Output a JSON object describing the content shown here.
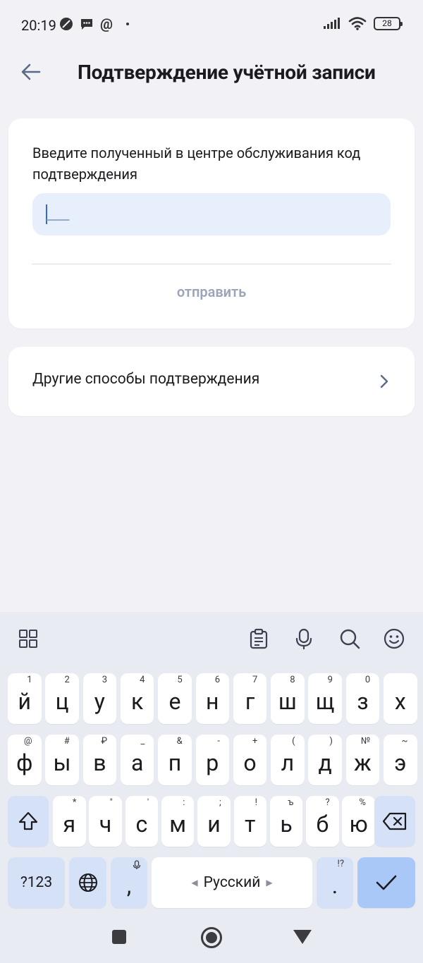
{
  "status_bar": {
    "time": "20:19",
    "battery": "28",
    "left_icons": [
      "moon-icon",
      "message-icon",
      "at-icon",
      "dot-icon"
    ],
    "right_icons": [
      "signal-icon",
      "wifi-icon",
      "battery-icon"
    ]
  },
  "header": {
    "title": "Подтверждение учётной записи",
    "back_icon": "arrow-left-icon"
  },
  "code_card": {
    "label": "Введите полученный в центре обслуживания код подтверждения",
    "input_value": "",
    "input_placeholder": "___",
    "send_label": "отправить"
  },
  "other_card": {
    "label": "Другие способы подтверждения",
    "chevron_icon": "chevron-right-icon"
  },
  "keyboard": {
    "toolbar": [
      "apps-grid-icon",
      "clipboard-icon",
      "mic-icon",
      "search-icon",
      "emoji-icon"
    ],
    "row1": [
      {
        "main": "й",
        "sub": "1"
      },
      {
        "main": "ц",
        "sub": "2"
      },
      {
        "main": "у",
        "sub": "3"
      },
      {
        "main": "к",
        "sub": "4"
      },
      {
        "main": "е",
        "sub": "5"
      },
      {
        "main": "н",
        "sub": "6"
      },
      {
        "main": "г",
        "sub": "7"
      },
      {
        "main": "ш",
        "sub": "8"
      },
      {
        "main": "щ",
        "sub": "9"
      },
      {
        "main": "з",
        "sub": "0"
      },
      {
        "main": "х",
        "sub": ""
      }
    ],
    "row2": [
      {
        "main": "ф",
        "sub": "@"
      },
      {
        "main": "ы",
        "sub": "#"
      },
      {
        "main": "в",
        "sub": "₽"
      },
      {
        "main": "а",
        "sub": "_"
      },
      {
        "main": "п",
        "sub": "&"
      },
      {
        "main": "р",
        "sub": "-"
      },
      {
        "main": "о",
        "sub": "+"
      },
      {
        "main": "л",
        "sub": "("
      },
      {
        "main": "д",
        "sub": ")"
      },
      {
        "main": "ж",
        "sub": "№"
      },
      {
        "main": "э",
        "sub": "~"
      }
    ],
    "row3": [
      {
        "main": "я",
        "sub": "*"
      },
      {
        "main": "ч",
        "sub": "\""
      },
      {
        "main": "с",
        "sub": "'"
      },
      {
        "main": "м",
        "sub": ":"
      },
      {
        "main": "и",
        "sub": ";"
      },
      {
        "main": "т",
        "sub": "!"
      },
      {
        "main": "ь",
        "sub": "ъ"
      },
      {
        "main": "б",
        "sub": "?"
      },
      {
        "main": "ю",
        "sub": "%"
      }
    ],
    "shift_icon": "shift-icon",
    "backspace_icon": "backspace-icon",
    "numbers_label": "?123",
    "globe_icon": "globe-icon",
    "comma": ",",
    "space_label": "Русский",
    "period": ".",
    "period_sub": "!?",
    "enter_icon": "checkmark-icon"
  },
  "navbar": [
    "square-icon",
    "home-circle-icon",
    "back-triangle-icon"
  ],
  "colors": {
    "background": "#f1f1f6",
    "card": "#ffffff",
    "input_bg": "#e7eefc",
    "caret": "#2d6bd8",
    "send_disabled": "#9aa5b8",
    "keyboard_bg": "#e9ebf3",
    "special_key": "#d5e1f7",
    "enter_key": "#a9c8f7"
  }
}
